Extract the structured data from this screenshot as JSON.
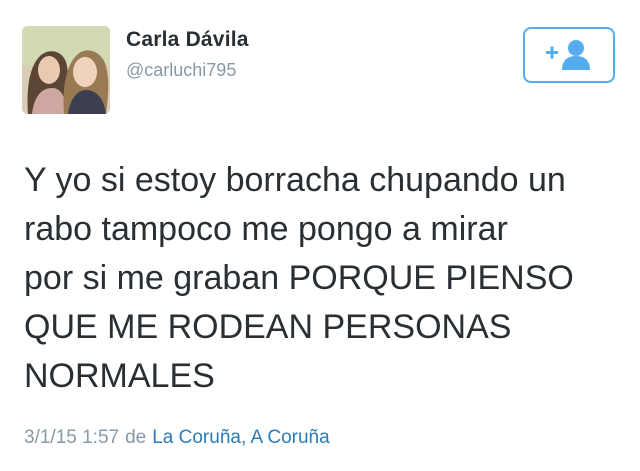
{
  "user": {
    "name": "Carla Dávila",
    "handle": "@carluchi795"
  },
  "follow_button": {
    "icon": "add-user-icon"
  },
  "tweet": {
    "text": "Y yo si estoy borracha chupando un\nrabo tampoco me pongo a mirar\npor si me graban PORQUE PIENSO\nQUE ME RODEAN PERSONAS\nNORMALES"
  },
  "meta": {
    "timestamp": "3/1/15 1:57",
    "connector": "de",
    "location": "La Coruña, A Coruña"
  },
  "colors": {
    "accent": "#55acee",
    "link": "#2b7bb9",
    "text": "#292f33",
    "muted": "#8899a6"
  }
}
